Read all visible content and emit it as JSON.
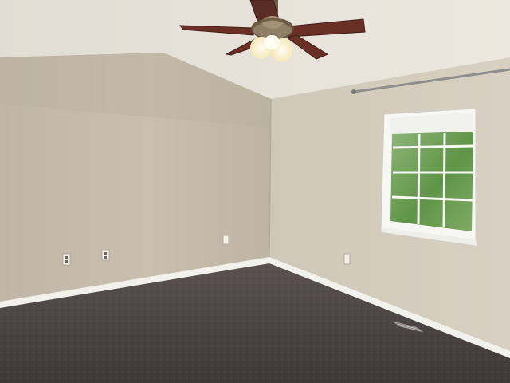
{
  "scene": {
    "description_colors": {
      "ceiling": "#e8e4dc",
      "left_wall": "#c9c0b1",
      "right_wall": "#d2cbbd",
      "carpet": "#4d4443",
      "trim": "#f2f1ec",
      "fan_blade": "#6a2f25",
      "fan_light": "#fff6d8",
      "window_glass": "#6f9f57",
      "curtain_rod": "#8f8f8f"
    }
  }
}
